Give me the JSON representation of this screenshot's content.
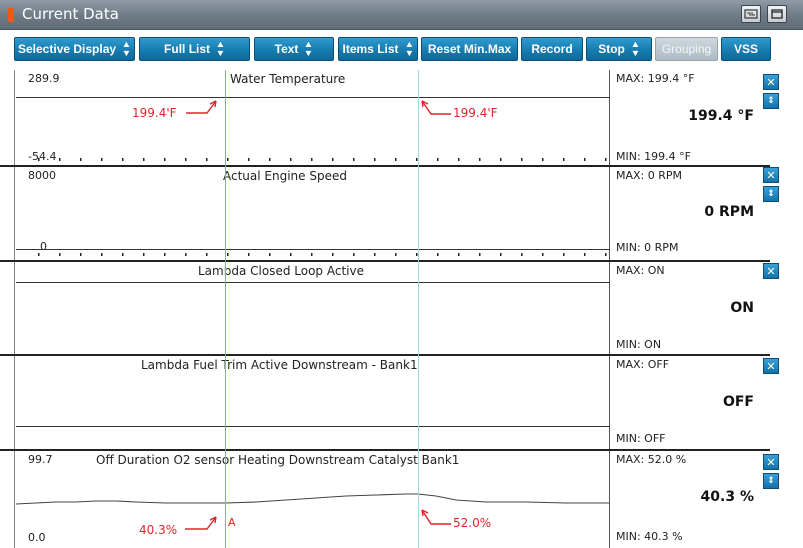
{
  "window": {
    "title": "Current Data"
  },
  "toolbar": [
    {
      "label": "Selective Display",
      "updown": true,
      "disabled": false
    },
    {
      "label": "Full List",
      "updown": true,
      "disabled": false
    },
    {
      "label": "Text",
      "updown": true,
      "disabled": false
    },
    {
      "label": "Items List",
      "updown": true,
      "disabled": false
    },
    {
      "label": "Reset Min.Max",
      "updown": false,
      "disabled": false
    },
    {
      "label": "Record",
      "updown": false,
      "disabled": false
    },
    {
      "label": "Stop",
      "updown": true,
      "disabled": false
    },
    {
      "label": "Grouping",
      "updown": false,
      "disabled": true
    },
    {
      "label": "VSS",
      "updown": false,
      "disabled": false
    }
  ],
  "panels": [
    {
      "name": "Water Temperature",
      "scale_max": "289.9",
      "scale_min": "-54.4",
      "max": "MAX: 199.4 °F",
      "current": "199.4 °F",
      "min": "MIN: 199.4 °F",
      "has_scroll": true
    },
    {
      "name": "Actual Engine Speed",
      "scale_max": "8000",
      "scale_min": "0",
      "max": "MAX:      0 RPM",
      "current": "0 RPM",
      "min": "MIN:      0 RPM",
      "has_scroll": true
    },
    {
      "name": "Lambda Closed Loop Active",
      "scale_max": "",
      "scale_min": "",
      "max": "MAX: ON",
      "current": "ON",
      "min": "MIN: ON",
      "has_scroll": false
    },
    {
      "name": "Lambda Fuel Trim Active Downstream - Bank1",
      "scale_max": "",
      "scale_min": "",
      "max": "MAX: OFF",
      "current": "OFF",
      "min": "MIN: OFF",
      "has_scroll": false
    },
    {
      "name": "Off Duration O2 sensor Heating Downstream Catalyst Bank1",
      "scale_max": "99.7",
      "scale_min": "0.0",
      "max": "MAX:  52.0 %",
      "current": "40.3 %",
      "min": "MIN:  40.3 %",
      "has_scroll": true
    }
  ],
  "annotations": {
    "temp_left": "199.4'F",
    "temp_right": "199.4'F",
    "o2_left": "40.3%",
    "o2_right": "52.0%",
    "cursor_label": "A"
  },
  "icons": {
    "close": "close-icon",
    "scroll": "scroll-updown-icon",
    "window_a": "connection-icon",
    "window_b": "window-restore-icon"
  },
  "colors": {
    "accent": "#1679ad",
    "cursor_a": "#f08a5d",
    "cursor_b": "#9fd9e8",
    "annotation": "#e0242b"
  }
}
